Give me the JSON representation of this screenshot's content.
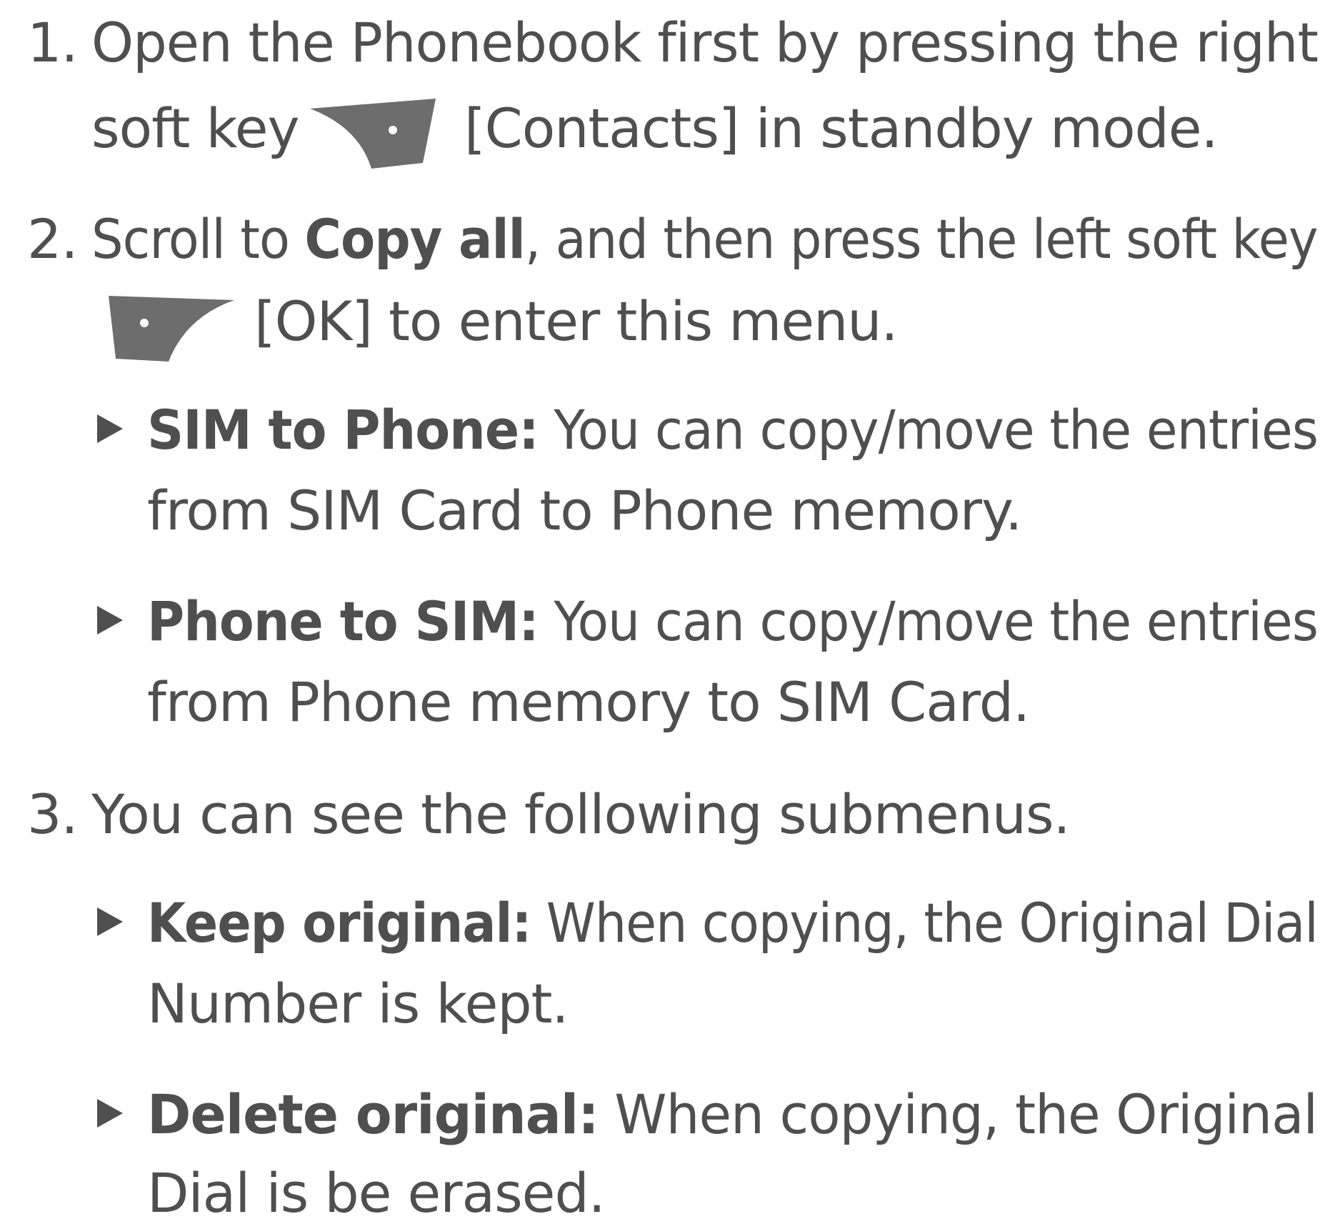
{
  "steps": [
    {
      "number": "1.",
      "line1": "Open the Phonebook first by pressing the right",
      "line2_before_icon": "soft key",
      "line2_after_icon": "[Contacts] in standby mode.",
      "icon": "right-soft-key-icon"
    },
    {
      "number": "2.",
      "line1_pre": "Scroll to ",
      "line1_bold": "Copy all",
      "line1_post": ", and then press the left soft key",
      "line2_after_icon": "[OK] to enter this menu.",
      "icon": "left-soft-key-icon"
    },
    {
      "number": "3.",
      "line1": "You can see the following submenus."
    }
  ],
  "copy_options": [
    {
      "term": "SIM to Phone:",
      "line1_rest": " You can copy/move the entries",
      "line2": "from SIM Card to Phone memory."
    },
    {
      "term": "Phone to SIM:",
      "line1_rest": " You can copy/move the entries",
      "line2": "from Phone memory to SIM Card."
    }
  ],
  "submenus": [
    {
      "term": "Keep original:",
      "line1_rest": " When copying, the Original Dial",
      "line2": "Number is kept."
    },
    {
      "term": "Delete original:",
      "line1_rest": " When copying, the Original",
      "line2": "Dial is be erased."
    }
  ],
  "colors": {
    "text": "#4f4f4f",
    "icon": "#6d6d6d",
    "background": "#ffffff"
  }
}
